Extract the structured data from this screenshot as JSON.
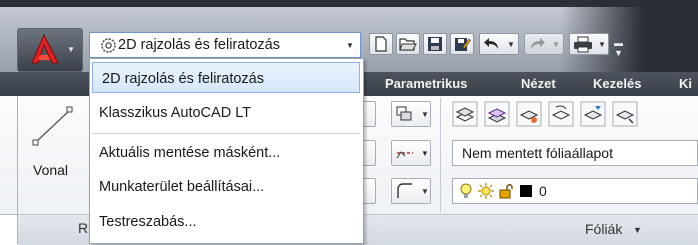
{
  "app": {
    "name": "AutoCAD LT",
    "accent": "#c0201e"
  },
  "workspace": {
    "current": "2D rajzolás és feliratozás",
    "options": [
      "2D rajzolás és feliratozás",
      "Klasszikus AutoCAD LT",
      "Aktuális mentése másként...",
      "Munkaterület beállításai...",
      "Testreszabás..."
    ]
  },
  "ribbon": {
    "tabs": [
      "Parametrikus",
      "Nézet",
      "Kezelés",
      "Ki"
    ],
    "draw_panel": {
      "line_label": "Vonal",
      "panel_letter": "R"
    },
    "layers_panel": {
      "layer_state": "Nem mentett fóliaállapot",
      "current_layer": "0",
      "title": "Fóliák"
    }
  },
  "icons": {
    "workspace": "gear-icon",
    "new": "new-file-icon",
    "open": "open-folder-icon",
    "save": "save-disk-icon",
    "saveas": "save-as-icon",
    "undo": "undo-icon",
    "redo": "redo-icon",
    "plot": "plot-printer-icon"
  }
}
